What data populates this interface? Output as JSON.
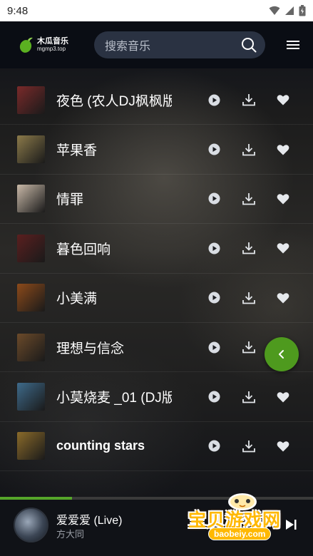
{
  "status_bar": {
    "time": "9:48"
  },
  "header": {
    "logo_title": "木瓜音乐",
    "logo_subtitle": "mgmp3.top",
    "search_placeholder": "搜索音乐"
  },
  "songs": [
    {
      "title": "夜色 (农人DJ枫枫版",
      "cover_color": "#7a2a2a"
    },
    {
      "title": "苹果香",
      "cover_color": "#8b7a4a"
    },
    {
      "title": "情罪",
      "cover_color": "#c9b9a8"
    },
    {
      "title": "暮色回响",
      "cover_color": "#5a1f1f"
    },
    {
      "title": "小美满",
      "cover_color": "#8c4a1a"
    },
    {
      "title": "理想与信念",
      "cover_color": "#6b4a2a"
    },
    {
      "title": "小莫烧麦 _01 (DJ版",
      "cover_color": "#3e6a8a"
    },
    {
      "title": "counting stars",
      "cover_color": "#8a6a2a"
    }
  ],
  "player": {
    "title": "爱爱爱 (Live)",
    "artist": "方大同",
    "progress": 0.23
  },
  "watermark": {
    "text": "宝贝游戏网",
    "url": "baobeiy.com"
  },
  "colors": {
    "accent": "#4e9a1e",
    "progress": "#55a52a",
    "header_bg": "#0a0d14",
    "search_bg": "#2a3242"
  }
}
